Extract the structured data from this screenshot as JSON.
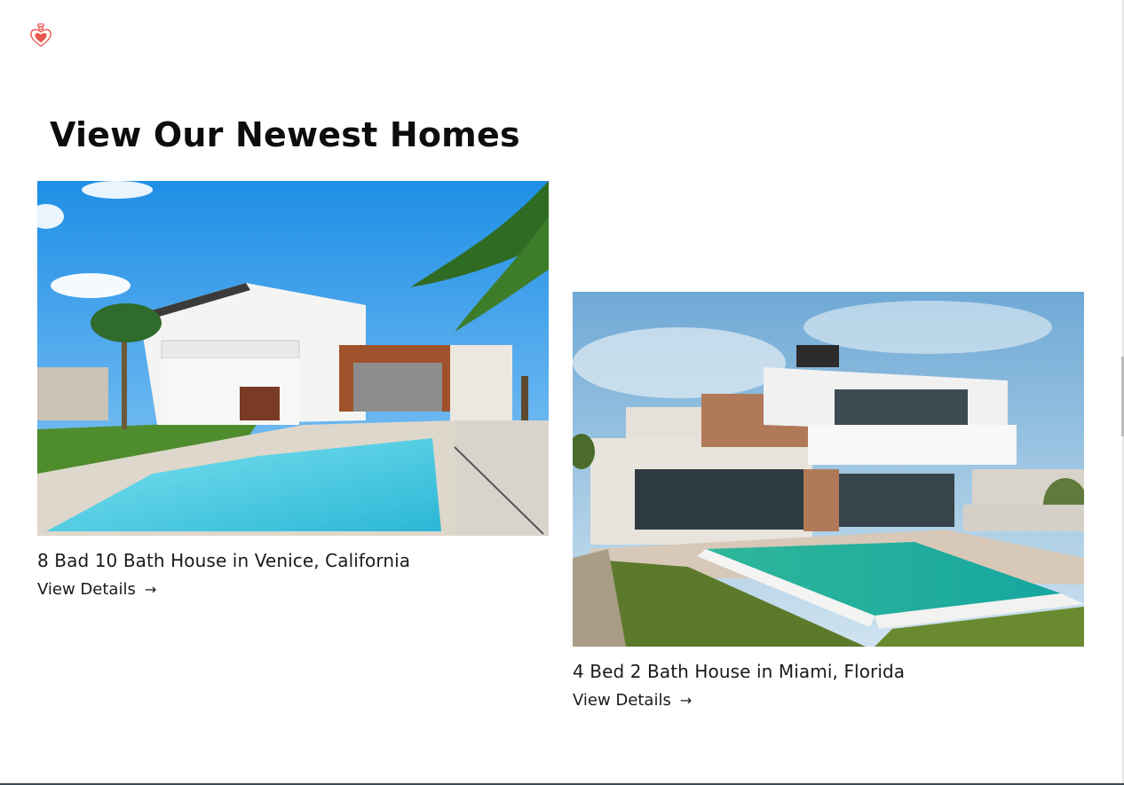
{
  "brand": {
    "logo_icon": "heart-potion-icon",
    "logo_color": "#e8584f"
  },
  "section": {
    "title": "View Our Newest Homes"
  },
  "listings": [
    {
      "title": "8 Bad 10 Bath House in Venice, California",
      "link": "View Details",
      "arrow": "→"
    },
    {
      "title": "4 Bed 2 Bath House in Miami, Florida",
      "link": "View Details",
      "arrow": "→"
    }
  ]
}
